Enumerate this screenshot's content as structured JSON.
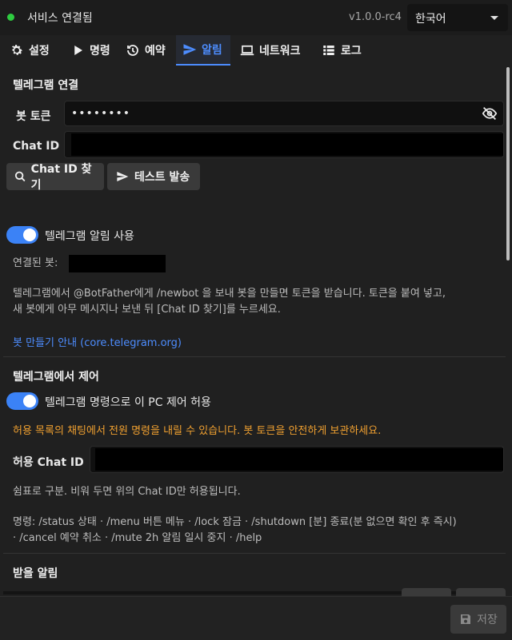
{
  "header": {
    "status_text": "서비스 연결됨",
    "version": "v1.0.0-rc4",
    "language": "한국어"
  },
  "tabs": [
    {
      "label": "설정"
    },
    {
      "label": "명령"
    },
    {
      "label": "예약"
    },
    {
      "label": "알림"
    },
    {
      "label": "네트워크"
    },
    {
      "label": "로그"
    }
  ],
  "telegram": {
    "section_title": "텔레그램 연결",
    "bot_token_label": "봇 토큰",
    "bot_token_value": "••••••••",
    "chat_id_label": "Chat ID",
    "find_chat_id_button": "Chat ID 찾기",
    "test_send_button": "테스트 발송",
    "enable_toggle_label": "텔레그램 알림 사용",
    "connected_bot_label": "연결된 봇:",
    "help_text_1": "텔레그램에서 @BotFather에게 /newbot 을 보내 봇을 만들면 토큰을 받습니다. 토큰을 붙여 넣고,",
    "help_text_2": "새 봇에게 아무 메시지나 보낸 뒤 [Chat ID 찾기]를 누르세요.",
    "guide_link": "봇 만들기 안내 (core.telegram.org)"
  },
  "control": {
    "section_title": "텔레그램에서 제어",
    "allow_toggle_label": "텔레그램 명령으로 이 PC 제어 허용",
    "warning": "허용 목록의 채팅에서 전원 명령을 내릴 수 있습니다. 봇 토큰을 안전하게 보관하세요.",
    "allowed_chat_id_label": "허용 Chat ID",
    "comma_help": "쉼표로 구분. 비워 두면 위의 Chat ID만 허용됩니다.",
    "commands_line_1": "명령: /status 상태 · /menu 버튼 메뉴 · /lock 잠금 · /shutdown [분] 종료(분 없으면 확인 후 즉시)",
    "commands_line_2": "· /cancel 예약 취소 · /mute 2h 알림 일시 중지 · /help"
  },
  "receive": {
    "section_title": "받을 알림"
  },
  "footer": {
    "save_button": "저장"
  },
  "colors": {
    "accent": "#4d8dff",
    "status_ok": "#2ecc40",
    "warning": "#f0a030",
    "toggle_on": "#3b82f6"
  },
  "icons": [
    "gear-icon",
    "play-icon",
    "history-icon",
    "send-icon",
    "laptop-icon",
    "list-icon",
    "eye-off-icon",
    "search-icon",
    "save-icon"
  ]
}
